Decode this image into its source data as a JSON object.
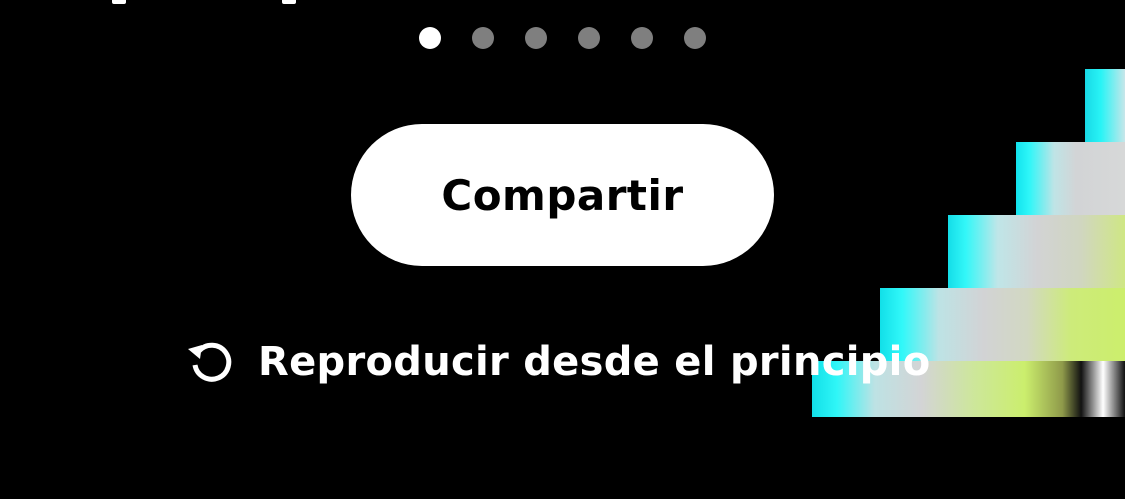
{
  "pagination": {
    "total": 6,
    "active_index": 0
  },
  "actions": {
    "share_label": "Compartir",
    "restart_label": "Reproducir desde el principio"
  },
  "icons": {
    "restart": "restart-icon"
  },
  "colors": {
    "background": "#000000",
    "dot_active": "#ffffff",
    "dot_inactive": "#7f7f7f",
    "button_bg": "#ffffff",
    "button_text": "#000000",
    "accent_cyan": "#2ef6f8",
    "accent_lime": "#ccee6c",
    "accent_gray": "#d2d3d5"
  }
}
